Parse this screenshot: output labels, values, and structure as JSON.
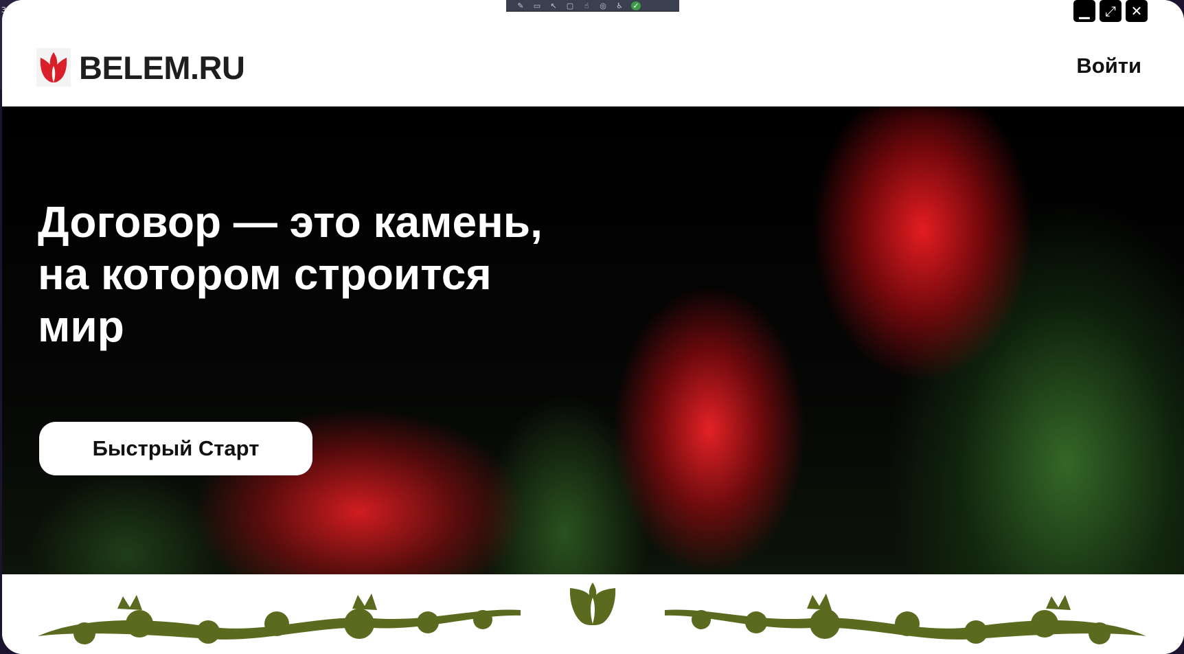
{
  "desktop": {
    "corner_text": "Зе"
  },
  "site": {
    "logo_text": "BELEM.RU",
    "login_label": "Войти"
  },
  "hero": {
    "title_lines": [
      "Договор — это камень,",
      "на котором строится",
      "мир"
    ],
    "cta_label": "Быстрый Старт"
  },
  "window_controls": {
    "minimize": "▁",
    "maximize": "⤢",
    "close": "✕"
  },
  "toolbar_icons": [
    "edit-icon",
    "record-icon",
    "pointer-icon",
    "frame-icon",
    "touch-icon",
    "audio-icon",
    "accessibility-icon",
    "check-icon"
  ],
  "colors": {
    "brand_red": "#d9202a",
    "ornament_green": "#5a6b1f",
    "text_dark": "#1e1e1e"
  }
}
